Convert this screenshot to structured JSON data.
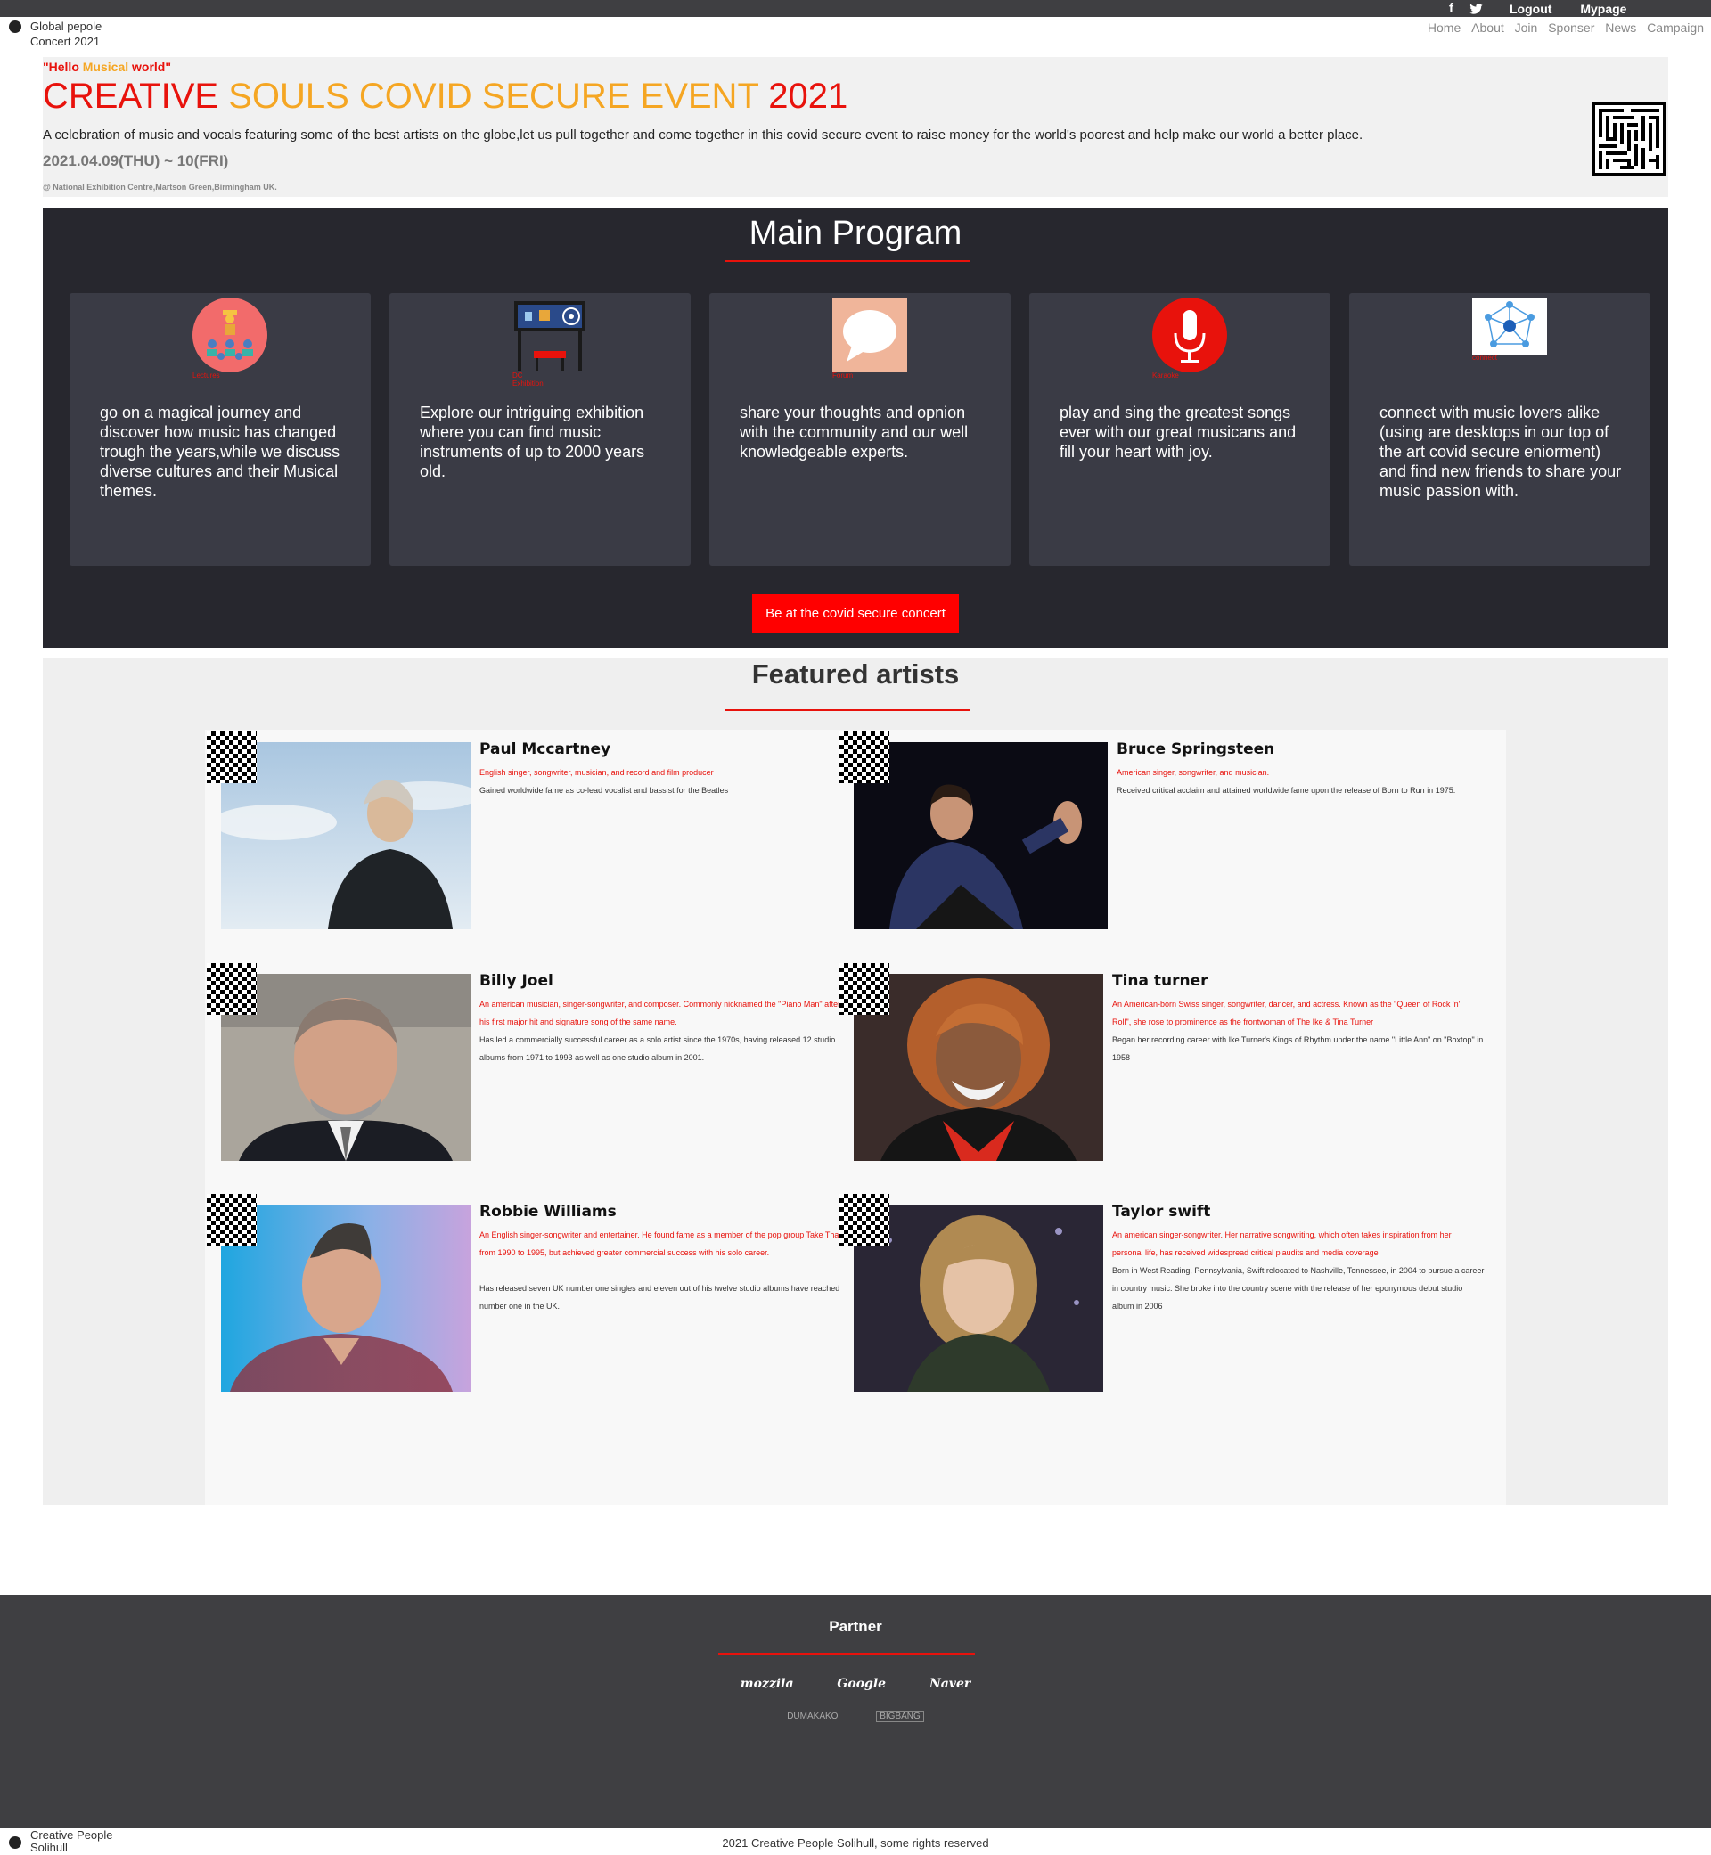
{
  "topbar": {
    "social": [
      "f",
      "t"
    ],
    "links": [
      "Logout",
      "Mypage"
    ]
  },
  "logo": {
    "text": "Global pepole Concert 2021"
  },
  "nav": [
    "Home",
    "About",
    "Join",
    "Sponser",
    "News",
    "Campaign"
  ],
  "hero": {
    "hello_1": "\"Hello ",
    "hello_2": "Musical",
    "hello_3": " world\"",
    "title_1": "CREATIVE ",
    "title_2": "SOULS COVID SECURE EVENT ",
    "title_3": "2021",
    "description": "A celebration of music and vocals featuring some of the best artists on the globe,let us pull together and come together in this covid secure event to raise money for the world's poorest and help make our world a better place.",
    "date": "2021.04.09(THU) ~ 10(FRI)",
    "venue": "@ National Exhibition Centre,Martson Green,Birmingham UK."
  },
  "program": {
    "title": "Main Program",
    "cards": [
      {
        "caption": "Lectures",
        "text": "go on a magical journey and discover how music has changed trough the years,while we discuss diverse cultures and their Musical themes."
      },
      {
        "caption": "DC Exhibition",
        "text": "Explore our intriguing exhibition where you can find music instruments of up to 2000 years old."
      },
      {
        "caption": "Forum",
        "text": "share your thoughts and opnion with the community and our well knowledgeable experts."
      },
      {
        "caption": "Karaoke",
        "text": "play and sing the greatest songs ever with our great musicans and fill your heart with joy."
      },
      {
        "caption": "connect",
        "text": "connect with music lovers alike (using are desktops in our top of the art covid secure eniorment) and find new friends to share your music passion with."
      }
    ],
    "cta": "Be at the covid secure concert"
  },
  "featured": {
    "title": "Featured artists",
    "artists": [
      {
        "name": "Paul Mccartney",
        "role": "English singer, songwriter, musician, and record and film producer",
        "bio": "Gained worldwide fame as co-lead vocalist and bassist for the Beatles"
      },
      {
        "name": "Bruce Springsteen",
        "role": "American singer, songwriter, and musician.",
        "bio": "Received critical acclaim and attained worldwide fame upon the release of Born to Run in 1975."
      },
      {
        "name": "Billy Joel",
        "role": "An american musician, singer-songwriter, and composer. Commonly nicknamed the \"Piano Man\" after his first major hit and signature song of the same name.",
        "bio": "Has led a commercially successful career as a solo artist since the 1970s, having released 12 studio albums from 1971 to 1993 as well as one studio album in 2001."
      },
      {
        "name": "Tina turner",
        "role": "An American-born Swiss singer, songwriter, dancer, and actress. Known as the \"Queen of Rock 'n' Roll\", she rose to prominence as the frontwoman of The Ike & Tina Turner",
        "bio": "Began her recording career with Ike Turner's Kings of Rhythm under the name \"Little Ann\" on \"Boxtop\" in 1958"
      },
      {
        "name": "Robbie Williams",
        "role": "An English singer-songwriter and entertainer. He found fame as a member of the pop group Take That from 1990 to 1995, but achieved greater commercial success with his solo career.",
        "bio": "Has released seven UK number one singles and eleven out of his twelve studio albums have reached number one in the UK."
      },
      {
        "name": "Taylor swift",
        "role": "An american singer-songwriter. Her narrative songwriting, which often takes inspiration from her personal life, has received widespread critical plaudits and media coverage",
        "bio": "Born in West Reading, Pennsylvania, Swift relocated to Nashville, Tennessee, in 2004 to pursue a career in country music. She broke into the country scene with the release of her eponymous debut studio album in 2006"
      }
    ]
  },
  "footer": {
    "title": "Partner",
    "partners": [
      "mozzila",
      "Google",
      "Naver"
    ],
    "partners2": [
      "DUMAKAKO",
      "BIGBANG"
    ]
  },
  "bottom": {
    "logo_text": "Creative People Solihull",
    "copyright": "2021 Creative People Solihull, some rights reserved"
  },
  "colors": {
    "accent_red": "#e8120c",
    "accent_orange": "#f5a623",
    "dark_bg": "#27272e",
    "card_bg": "#3a3b45",
    "footer_bg": "#3f3f42"
  }
}
